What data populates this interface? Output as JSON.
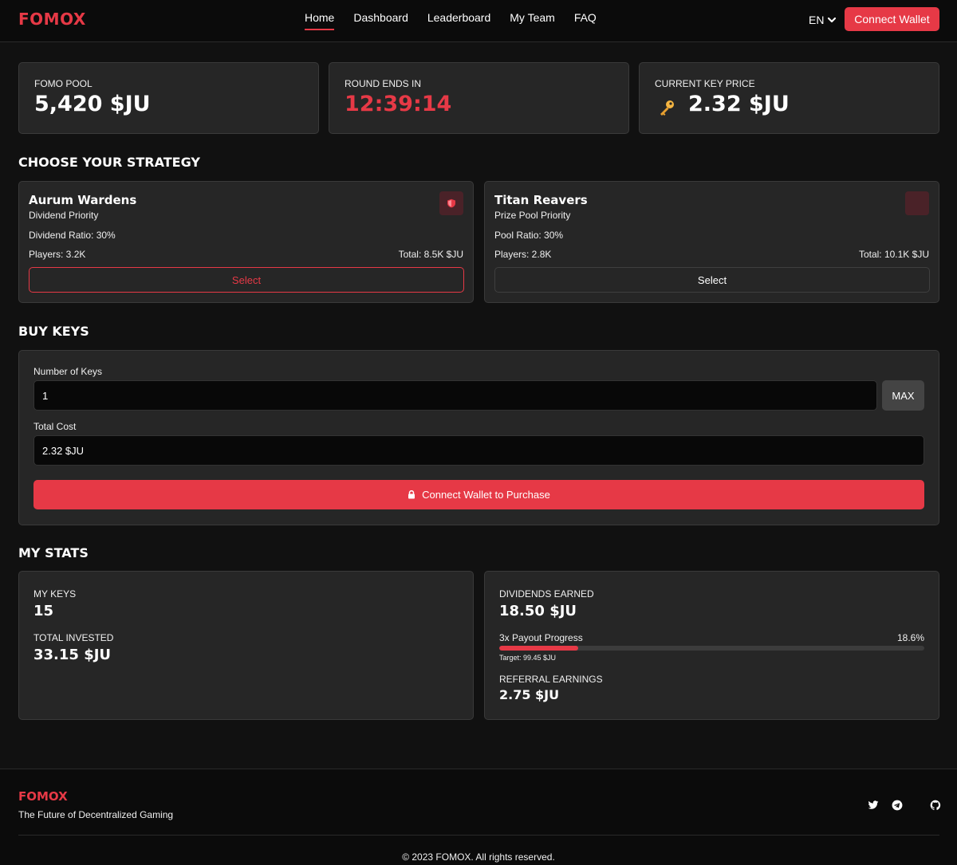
{
  "header": {
    "logo": "FOMOX",
    "nav": [
      {
        "label": "Home",
        "active": true
      },
      {
        "label": "Dashboard"
      },
      {
        "label": "Leaderboard"
      },
      {
        "label": "My Team"
      },
      {
        "label": "FAQ"
      }
    ],
    "language": "EN",
    "connect_label": "Connect Wallet"
  },
  "stats": {
    "pool": {
      "label": "FOMO POOL",
      "value": "5,420 $JU"
    },
    "round": {
      "label": "ROUND ENDS IN",
      "value": "12:39:14"
    },
    "price": {
      "label": "CURRENT KEY PRICE",
      "value": "2.32 $JU",
      "icon": "key-icon"
    }
  },
  "strategy": {
    "title": "CHOOSE YOUR STRATEGY",
    "teams": [
      {
        "name": "Aurum Wardens",
        "subtitle": "Dividend Priority",
        "ratio": "Dividend Ratio: 30%",
        "players": "Players: 3.2K",
        "total": "Total: 8.5K $JU",
        "button": "Select",
        "selected": true,
        "icon": "shield-icon"
      },
      {
        "name": "Titan Reavers",
        "subtitle": "Prize Pool Priority",
        "ratio": "Pool Ratio: 30%",
        "players": "Players: 2.8K",
        "total": "Total: 10.1K $JU",
        "button": "Select",
        "selected": false
      }
    ]
  },
  "buy": {
    "title": "BUY KEYS",
    "keys_label": "Number of Keys",
    "keys_value": "1",
    "max_label": "MAX",
    "cost_label": "Total Cost",
    "cost_value": "2.32 $JU",
    "purchase_label": "Connect Wallet to Purchase",
    "purchase_icon": "lock-icon"
  },
  "my_stats": {
    "title": "MY STATS",
    "keys_label": "MY KEYS",
    "keys_value": "15",
    "invested_label": "TOTAL INVESTED",
    "invested_value": "33.15 $JU",
    "dividends_label": "DIVIDENDS EARNED",
    "dividends_value": "18.50 $JU",
    "payout_label": "3x Payout Progress",
    "payout_percent": "18.6%",
    "payout_fraction": 0.186,
    "payout_target": "Target: 99.45 $JU",
    "referral_label": "REFERRAL EARNINGS",
    "referral_value": "2.75 $JU"
  },
  "footer": {
    "logo": "FOMOX",
    "tagline": "The Future of Decentralized Gaming",
    "social": [
      "twitter-icon",
      "telegram-icon",
      "github-icon"
    ],
    "copyright": "© 2023 FOMOX. All rights reserved."
  },
  "colors": {
    "accent": "#e63946",
    "card": "#262626",
    "background": "#111111"
  }
}
